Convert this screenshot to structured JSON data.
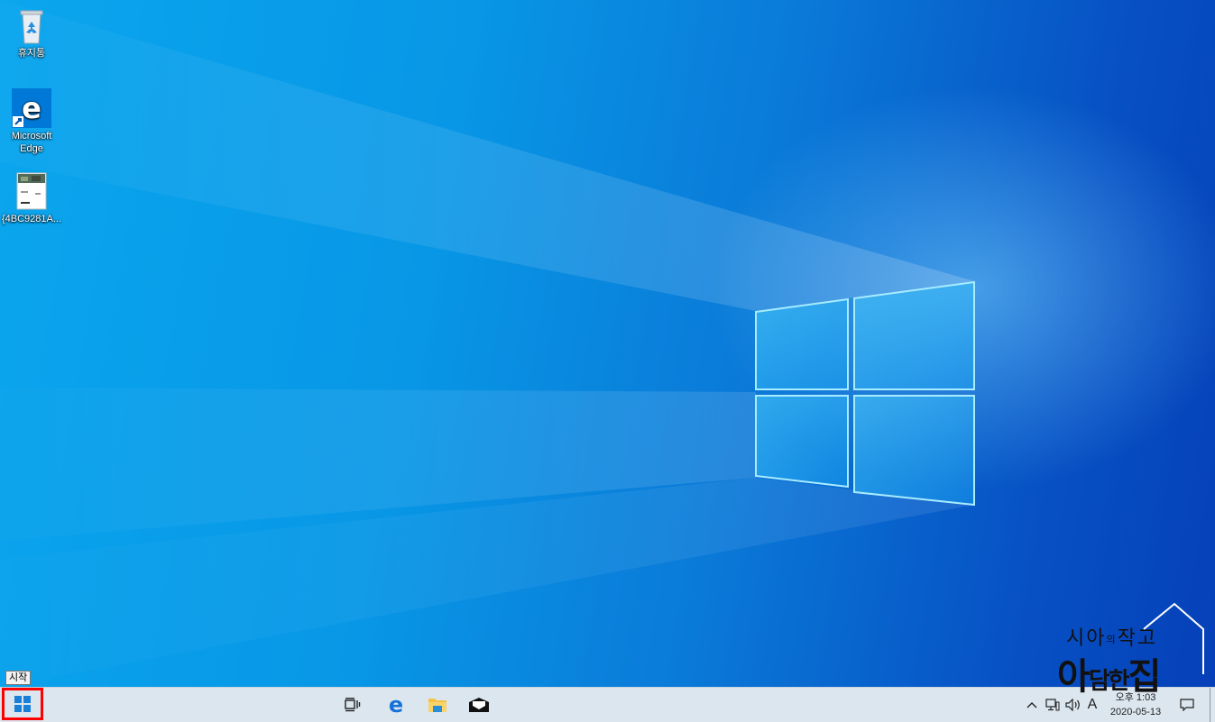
{
  "desktop": {
    "icons": [
      {
        "label": "휴지통"
      },
      {
        "label": "Microsoft\nEdge"
      },
      {
        "label": "{4BC9281A..."
      }
    ]
  },
  "start_tooltip": "시작",
  "taskbar": {
    "ime_label": "A",
    "clock_time": "오후 1:03",
    "clock_date": "2020-05-13"
  },
  "watermark": {
    "line1_a": "시아",
    "line1_b": "의",
    "line1_c": "작고",
    "line2_a": "아",
    "line2_b": "담한",
    "line2_c": "집"
  },
  "colors": {
    "accent": "#0078d7",
    "highlight_box": "#ff0000"
  }
}
